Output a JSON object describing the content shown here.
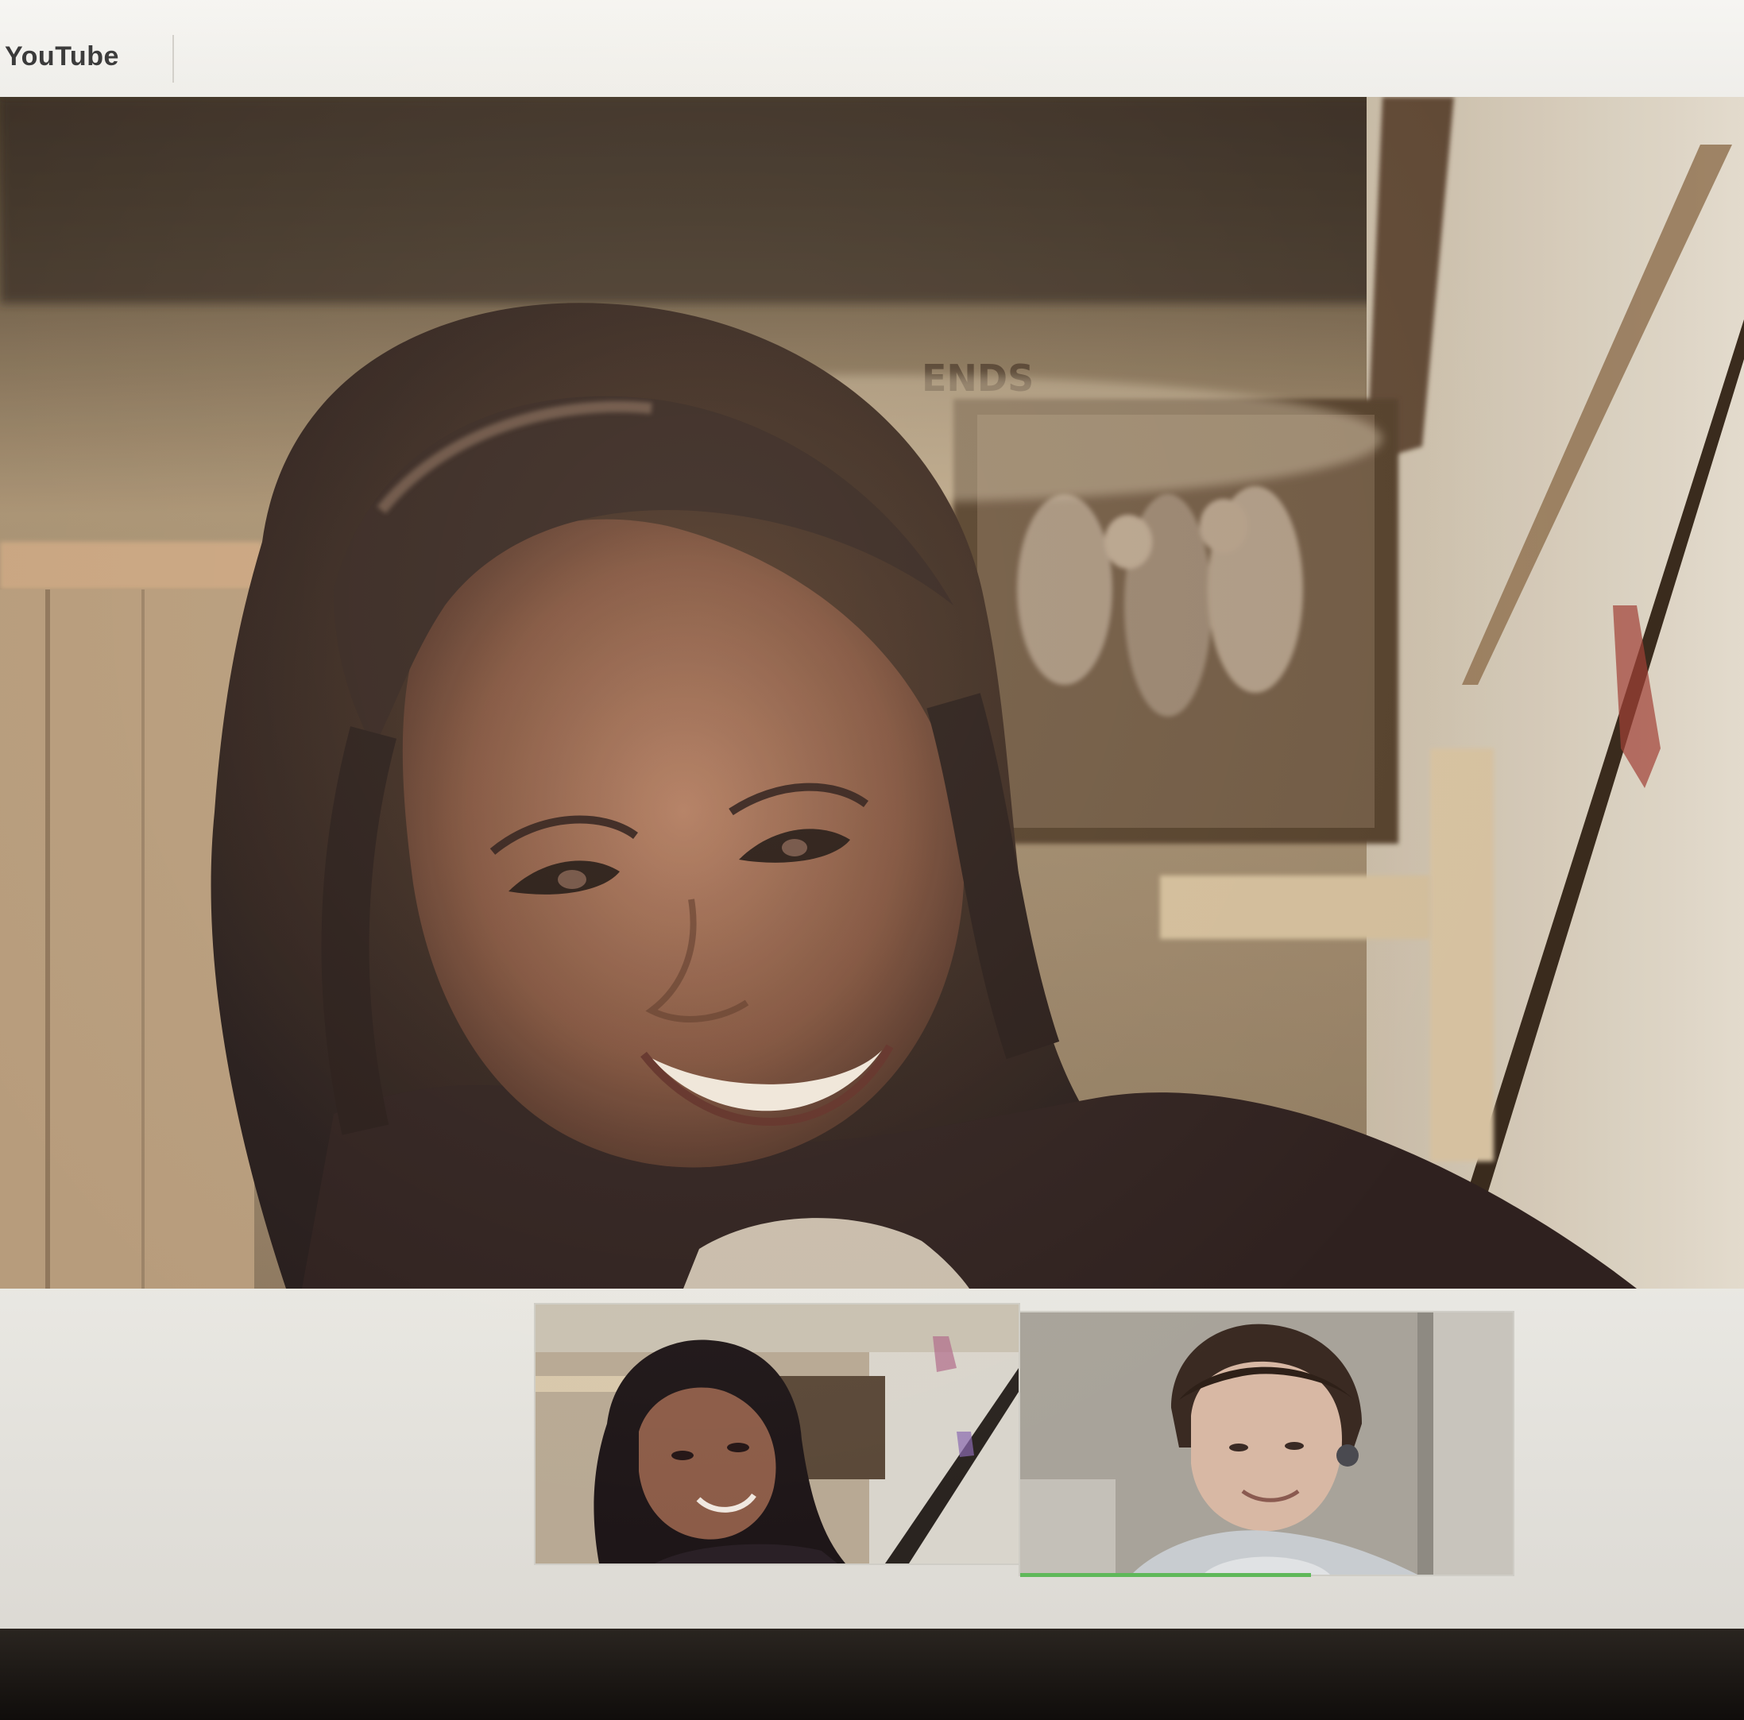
{
  "topbar": {
    "title": "YouTube"
  },
  "main_video": {
    "poster_text": "ENDS"
  },
  "participants": [
    {
      "role": "self-view"
    },
    {
      "role": "participant",
      "speaking": true
    }
  ],
  "colors": {
    "speaking_indicator": "#5fb85a",
    "page_background": "#ecebe6"
  }
}
